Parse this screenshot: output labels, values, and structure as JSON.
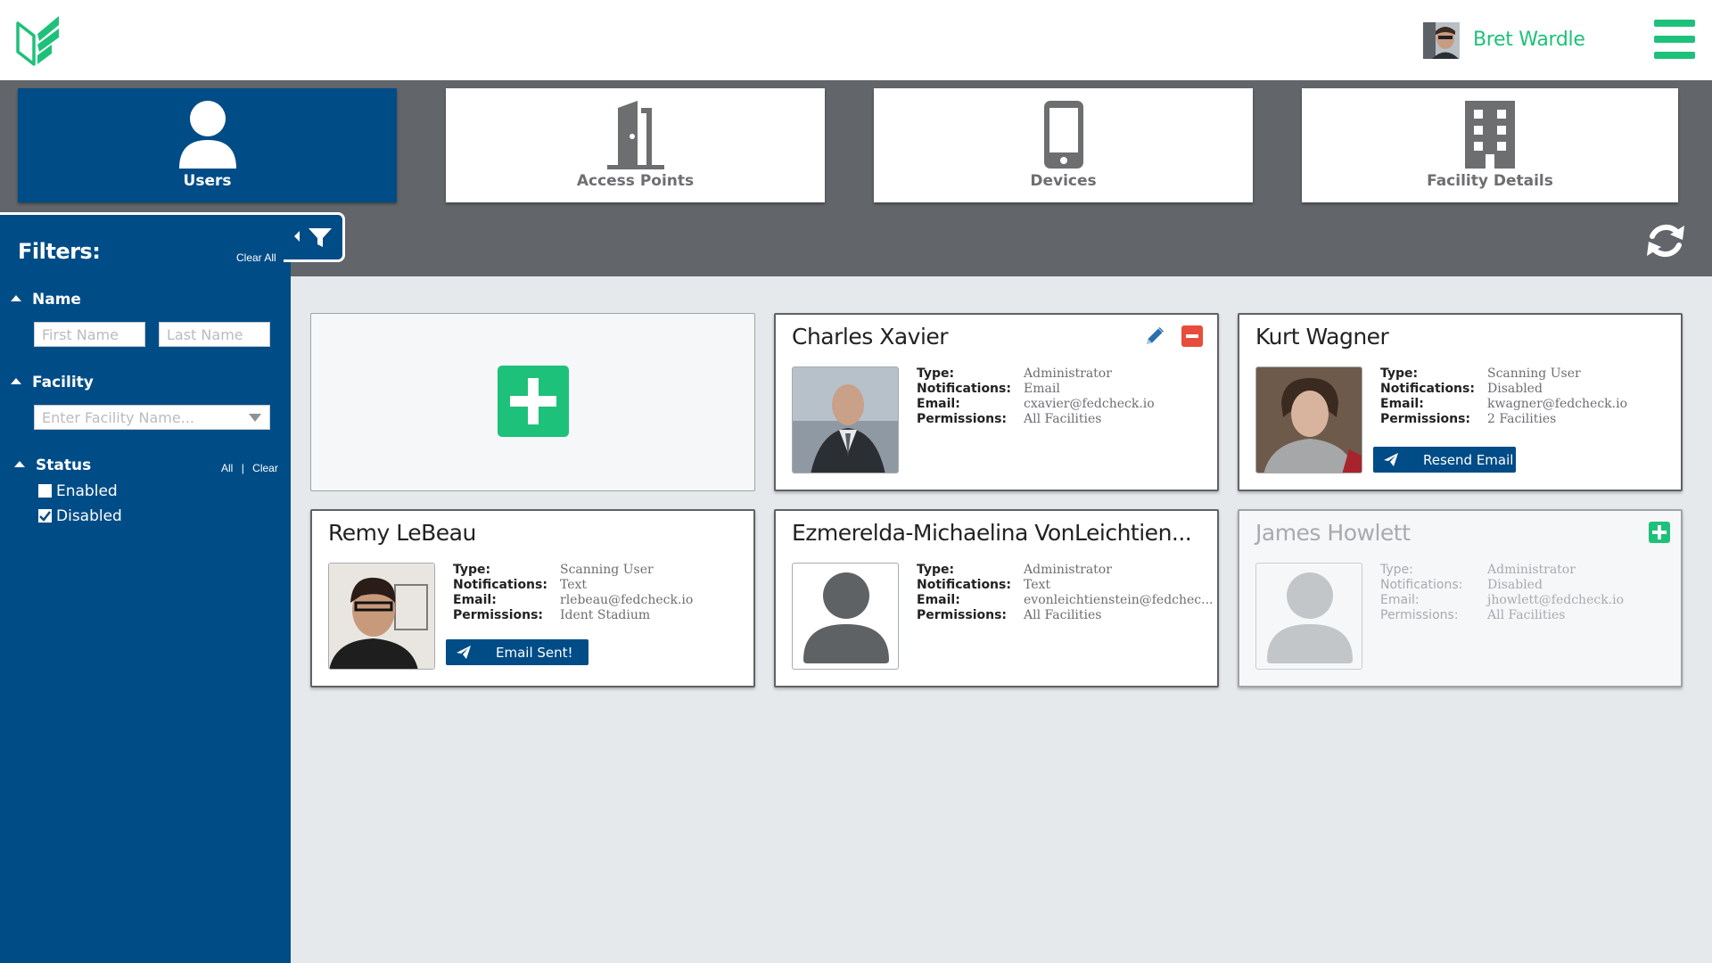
{
  "header": {
    "logo": "fedcheck-logo",
    "user_name": "Bret Wardle",
    "menu_icon": "hamburger-icon"
  },
  "nav": {
    "tiles": [
      {
        "label": "Users",
        "icon": "user-icon",
        "active": true
      },
      {
        "label": "Access Points",
        "icon": "door-icon",
        "active": false
      },
      {
        "label": "Devices",
        "icon": "phone-icon",
        "active": false
      },
      {
        "label": "Facility Details",
        "icon": "building-icon",
        "active": false
      }
    ]
  },
  "filters": {
    "title": "Filters:",
    "clear_all": "Clear All",
    "name_section": "Name",
    "first_name_placeholder": "First Name",
    "last_name_placeholder": "Last Name",
    "facility_section": "Facility",
    "facility_placeholder": "Enter Facility Name...",
    "status_section": "Status",
    "status_all": "All",
    "status_sep": "|",
    "status_clear": "Clear",
    "statuses": [
      {
        "label": "Enabled",
        "checked": false
      },
      {
        "label": "Disabled",
        "checked": true
      }
    ]
  },
  "labels": {
    "type": "Type:",
    "notifications": "Notifications:",
    "email": "Email:",
    "permissions": "Permissions:"
  },
  "users": [
    {
      "name": "Charles Xavier",
      "type": "Administrator",
      "notifications": "Email",
      "email": "cxavier@fedcheck.io",
      "permissions": "All Facilities"
    },
    {
      "name": "Kurt Wagner",
      "type": "Scanning User",
      "notifications": "Disabled",
      "email": "kwagner@fedcheck.io",
      "permissions": "2 Facilities",
      "button": "Resend Email"
    },
    {
      "name": "Remy LeBeau",
      "type": "Scanning User",
      "notifications": "Text",
      "email": "rlebeau@fedcheck.io",
      "permissions": "Ident Stadium",
      "button": "Email Sent!"
    },
    {
      "name": "Ezmerelda-Michaelina VonLeichtien...",
      "type": "Administrator",
      "notifications": "Text",
      "email": "evonleichtienstein@fedchec...",
      "permissions": "All Facilities"
    },
    {
      "name": "James Howlett",
      "type": "Administrator",
      "notifications": "Disabled",
      "email": "jhowlett@fedcheck.io",
      "permissions": "All Facilities"
    }
  ],
  "colors": {
    "brand_green": "#1ec17a",
    "nav_blue": "#004c87",
    "band_gray": "#62666a",
    "remove_red": "#e74c3c"
  }
}
